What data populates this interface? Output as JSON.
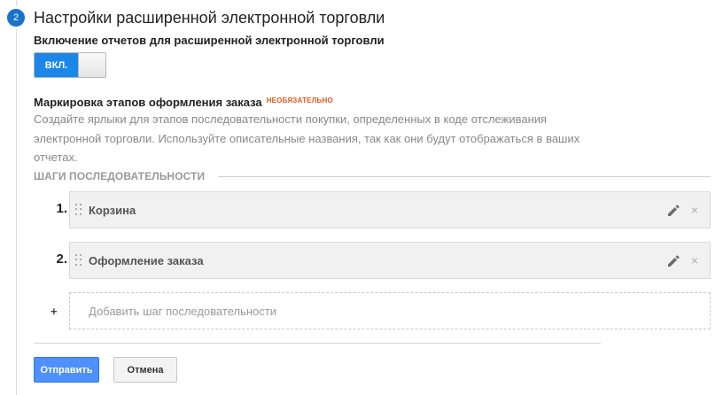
{
  "step_number": "2",
  "title": "Настройки расширенной электронной торговли",
  "reports_toggle": {
    "label": "Включение отчетов для расширенной электронной торговли",
    "state_label": "ВКЛ."
  },
  "funnel_section": {
    "label": "Маркировка этапов оформления заказа",
    "optional_badge": "НЕОБЯЗАТЕЛЬНО",
    "description": "Создайте ярлыки для этапов последовательности покупки, определенных в коде отслеживания электронной торговли. Используйте описательные названия, так как они будут отображаться в ваших отчетах."
  },
  "steps_heading": "ШАГИ ПОСЛЕДОВАТЕЛЬНОСТИ",
  "steps": [
    {
      "number": "1.",
      "name": "Корзина"
    },
    {
      "number": "2.",
      "name": "Оформление заказа"
    }
  ],
  "add_step": {
    "plus": "+",
    "placeholder": "Добавить шаг последовательности"
  },
  "buttons": {
    "submit": "Отправить",
    "cancel": "Отмена"
  },
  "icons": {
    "edit": "pencil-icon",
    "remove": "close-icon",
    "drag": "drag-handle-icon"
  },
  "colors": {
    "accent": "#1b87e8",
    "primary_button": "#4d90fe",
    "optional": "#e2571e"
  }
}
